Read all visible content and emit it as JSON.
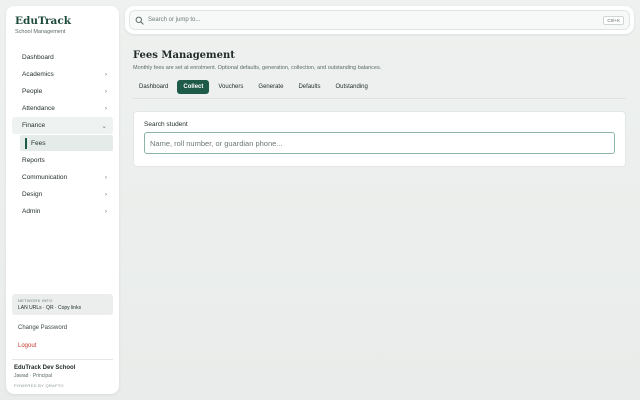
{
  "brand": {
    "title": "EduTrack",
    "subtitle": "School Management"
  },
  "nav": {
    "dashboard": "Dashboard",
    "academics": "Academics",
    "people": "People",
    "attendance": "Attendance",
    "finance": "Finance",
    "fees": "Fees",
    "reports": "Reports",
    "communication": "Communication",
    "design": "Design",
    "admin": "Admin"
  },
  "network": {
    "label": "NETWORK INFO",
    "text": "LAN URLs · QR · Copy links"
  },
  "links": {
    "change_password": "Change Password",
    "logout": "Logout"
  },
  "school": {
    "name": "EduTrack Dev School",
    "user": "Jawad · Principal",
    "powered": "POWERED BY QRAFTO"
  },
  "search": {
    "placeholder": "Search or jump to...",
    "shortcut": "Ctrl+K"
  },
  "page": {
    "title": "Fees Management",
    "subtitle": "Monthly fees are set at enrolment. Optional defaults, generation, collection, and outstanding balances."
  },
  "tabs": [
    "Dashboard",
    "Collect",
    "Vouchers",
    "Generate",
    "Defaults",
    "Outstanding"
  ],
  "card": {
    "label": "Search student",
    "placeholder": "Name, roll number, or guardian phone..."
  },
  "colors": {
    "accent": "#1d5a47",
    "logout": "#c0392b"
  }
}
